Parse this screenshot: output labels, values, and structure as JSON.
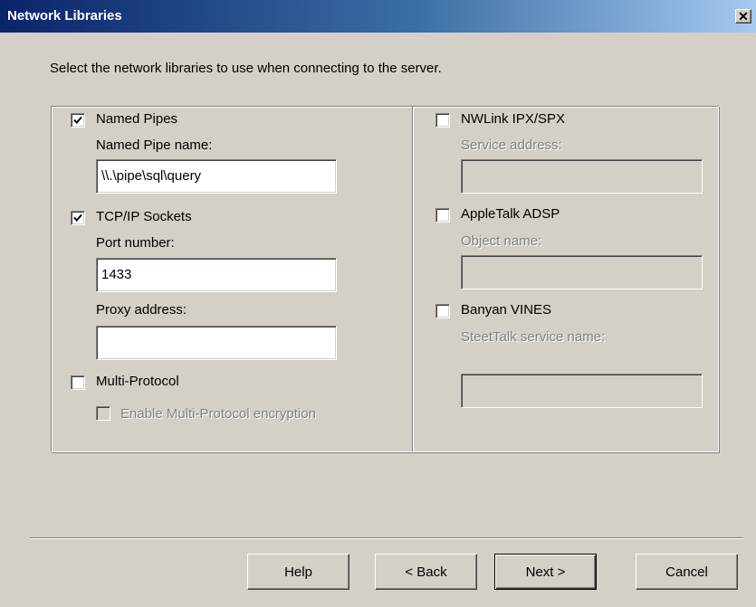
{
  "window": {
    "title": "Network Libraries",
    "close_glyph": "✕"
  },
  "instruction": "Select the network libraries to use when connecting to the server.",
  "left": {
    "named_pipes": {
      "label": "Named Pipes",
      "checked": true,
      "field_label": "Named Pipe name:",
      "field_value": "\\\\.\\pipe\\sql\\query"
    },
    "tcpip": {
      "label": "TCP/IP Sockets",
      "checked": true,
      "port_label": "Port number:",
      "port_value": "1433",
      "proxy_label": "Proxy address:",
      "proxy_value": ""
    },
    "multi_protocol": {
      "label": "Multi-Protocol",
      "checked": false,
      "encryption_label": "Enable Multi-Protocol encryption",
      "encryption_checked": false,
      "encryption_enabled": false
    }
  },
  "right": {
    "nwlink": {
      "label": "NWLink IPX/SPX",
      "checked": false,
      "field_label": "Service address:",
      "field_value": ""
    },
    "appletalk": {
      "label": "AppleTalk ADSP",
      "checked": false,
      "field_label": "Object name:",
      "field_value": ""
    },
    "banyan": {
      "label": "Banyan VINES",
      "checked": false,
      "field_label": "SteetTalk service name:",
      "field_value": ""
    }
  },
  "buttons": {
    "help": "Help",
    "back": "< Back",
    "next": "Next >",
    "cancel": "Cancel"
  }
}
